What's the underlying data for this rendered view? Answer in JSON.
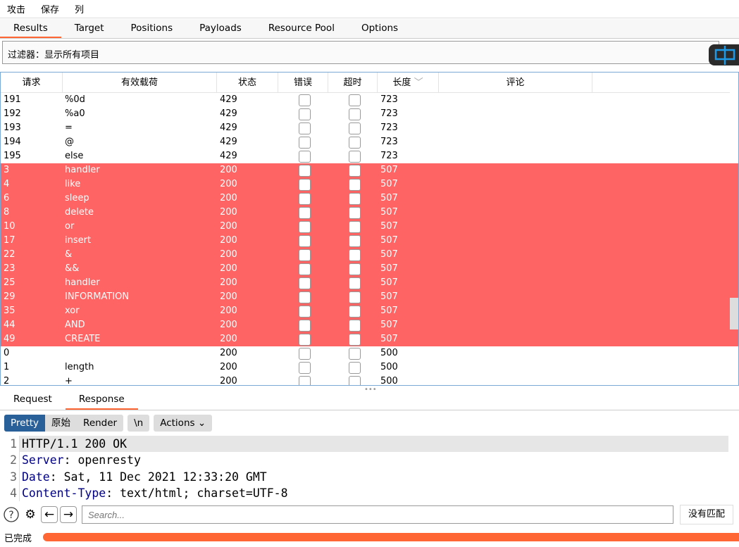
{
  "menu": [
    "攻击",
    "保存",
    "列"
  ],
  "tabs": [
    "Results",
    "Target",
    "Positions",
    "Payloads",
    "Resource Pool",
    "Options"
  ],
  "active_tab": "Results",
  "filter": "过滤器：显示所有项目",
  "ime_icon": "中",
  "table": {
    "headers": [
      "请求",
      "有效载荷",
      "状态",
      "错误",
      "超时",
      "长度",
      "评论"
    ],
    "sort_column": "长度",
    "highlight_color": "#ff6464",
    "rows": [
      {
        "req": "191",
        "payload": "%0d",
        "status": "429",
        "len": "723",
        "red": false
      },
      {
        "req": "192",
        "payload": "%a0",
        "status": "429",
        "len": "723",
        "red": false
      },
      {
        "req": "193",
        "payload": "=",
        "status": "429",
        "len": "723",
        "red": false
      },
      {
        "req": "194",
        "payload": "@",
        "status": "429",
        "len": "723",
        "red": false
      },
      {
        "req": "195",
        "payload": "else",
        "status": "429",
        "len": "723",
        "red": false
      },
      {
        "req": "3",
        "payload": "handler",
        "status": "200",
        "len": "507",
        "red": true
      },
      {
        "req": "4",
        "payload": "like",
        "status": "200",
        "len": "507",
        "red": true
      },
      {
        "req": "6",
        "payload": "sleep",
        "status": "200",
        "len": "507",
        "red": true
      },
      {
        "req": "8",
        "payload": "delete",
        "status": "200",
        "len": "507",
        "red": true
      },
      {
        "req": "10",
        "payload": "or",
        "status": "200",
        "len": "507",
        "red": true
      },
      {
        "req": "17",
        "payload": "insert",
        "status": "200",
        "len": "507",
        "red": true
      },
      {
        "req": "22",
        "payload": "&",
        "status": "200",
        "len": "507",
        "red": true
      },
      {
        "req": "23",
        "payload": "&&",
        "status": "200",
        "len": "507",
        "red": true
      },
      {
        "req": "25",
        "payload": "handler",
        "status": "200",
        "len": "507",
        "red": true
      },
      {
        "req": "29",
        "payload": "INFORMATION",
        "status": "200",
        "len": "507",
        "red": true
      },
      {
        "req": "35",
        "payload": "xor",
        "status": "200",
        "len": "507",
        "red": true
      },
      {
        "req": "44",
        "payload": "AND",
        "status": "200",
        "len": "507",
        "red": true
      },
      {
        "req": "49",
        "payload": "CREATE",
        "status": "200",
        "len": "507",
        "red": true
      },
      {
        "req": "0",
        "payload": "",
        "status": "200",
        "len": "500",
        "red": false
      },
      {
        "req": "1",
        "payload": "length",
        "status": "200",
        "len": "500",
        "red": false
      },
      {
        "req": "2",
        "payload": "+",
        "status": "200",
        "len": "500",
        "red": false
      }
    ]
  },
  "reqres_tabs": [
    "Request",
    "Response"
  ],
  "active_reqres": "Response",
  "view_buttons": [
    "Pretty",
    "原始",
    "Render"
  ],
  "newline_button": "\\n",
  "actions_button": "Actions",
  "code_lines": [
    {
      "n": "1",
      "key": "",
      "text": "HTTP/1.1 200 OK"
    },
    {
      "n": "2",
      "key": "Server",
      "text": ": openresty"
    },
    {
      "n": "3",
      "key": "Date",
      "text": ": Sat, 11 Dec 2021 12:33:20 GMT"
    },
    {
      "n": "4",
      "key": "Content-Type",
      "text": ": text/html; charset=UTF-8"
    }
  ],
  "search_placeholder": "Search...",
  "no_match": "没有匹配",
  "status": "已完成",
  "progress": 1.0,
  "accent": "#ff6633"
}
